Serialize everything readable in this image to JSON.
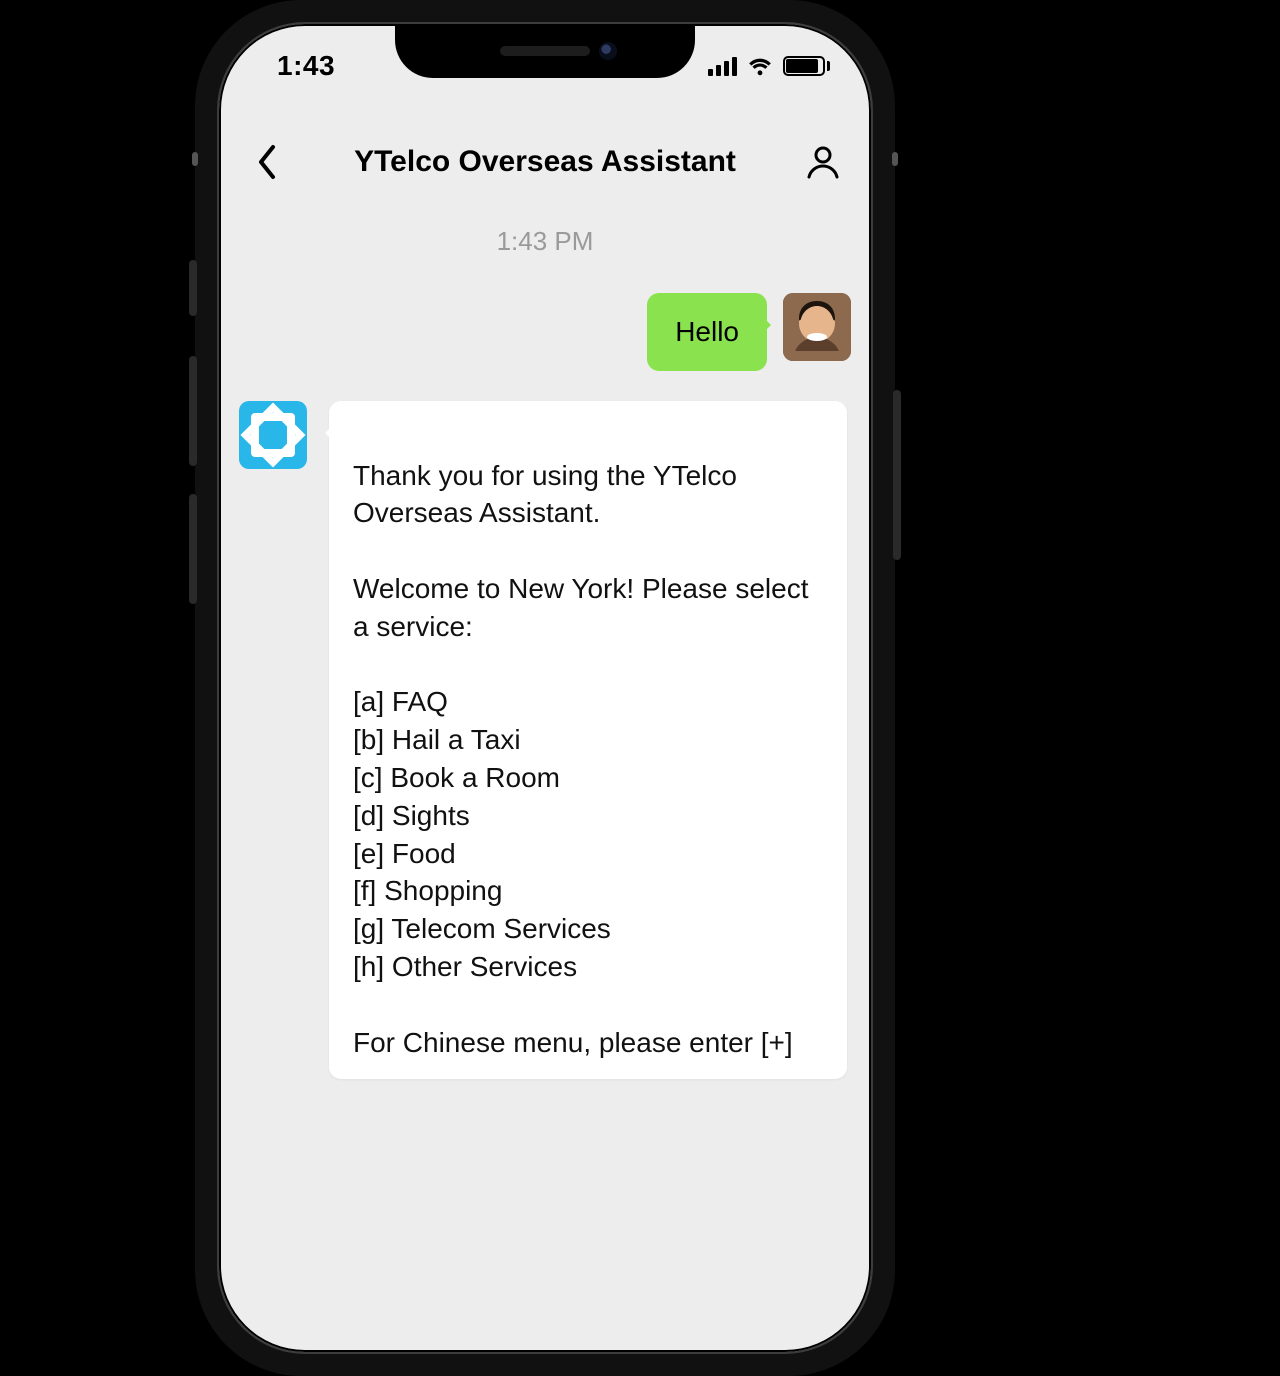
{
  "status": {
    "time": "1:43"
  },
  "nav": {
    "title": "YTelco Overseas Assistant"
  },
  "chat": {
    "timestamp": "1:43 PM",
    "user_message": "Hello",
    "bot_message": "Thank you for using the YTelco Overseas Assistant.\n\nWelcome to New York! Please select a service:\n\n[a] FAQ\n[b] Hail a Taxi\n[c] Book a Room\n[d] Sights\n[e] Food\n[f] Shopping\n[g] Telecom Services\n[h] Other Services\n\nFor Chinese menu, please enter [+]"
  },
  "colors": {
    "user_bubble": "#8ae34e",
    "bot_avatar": "#29b6e8",
    "screen_bg": "#ededed"
  }
}
